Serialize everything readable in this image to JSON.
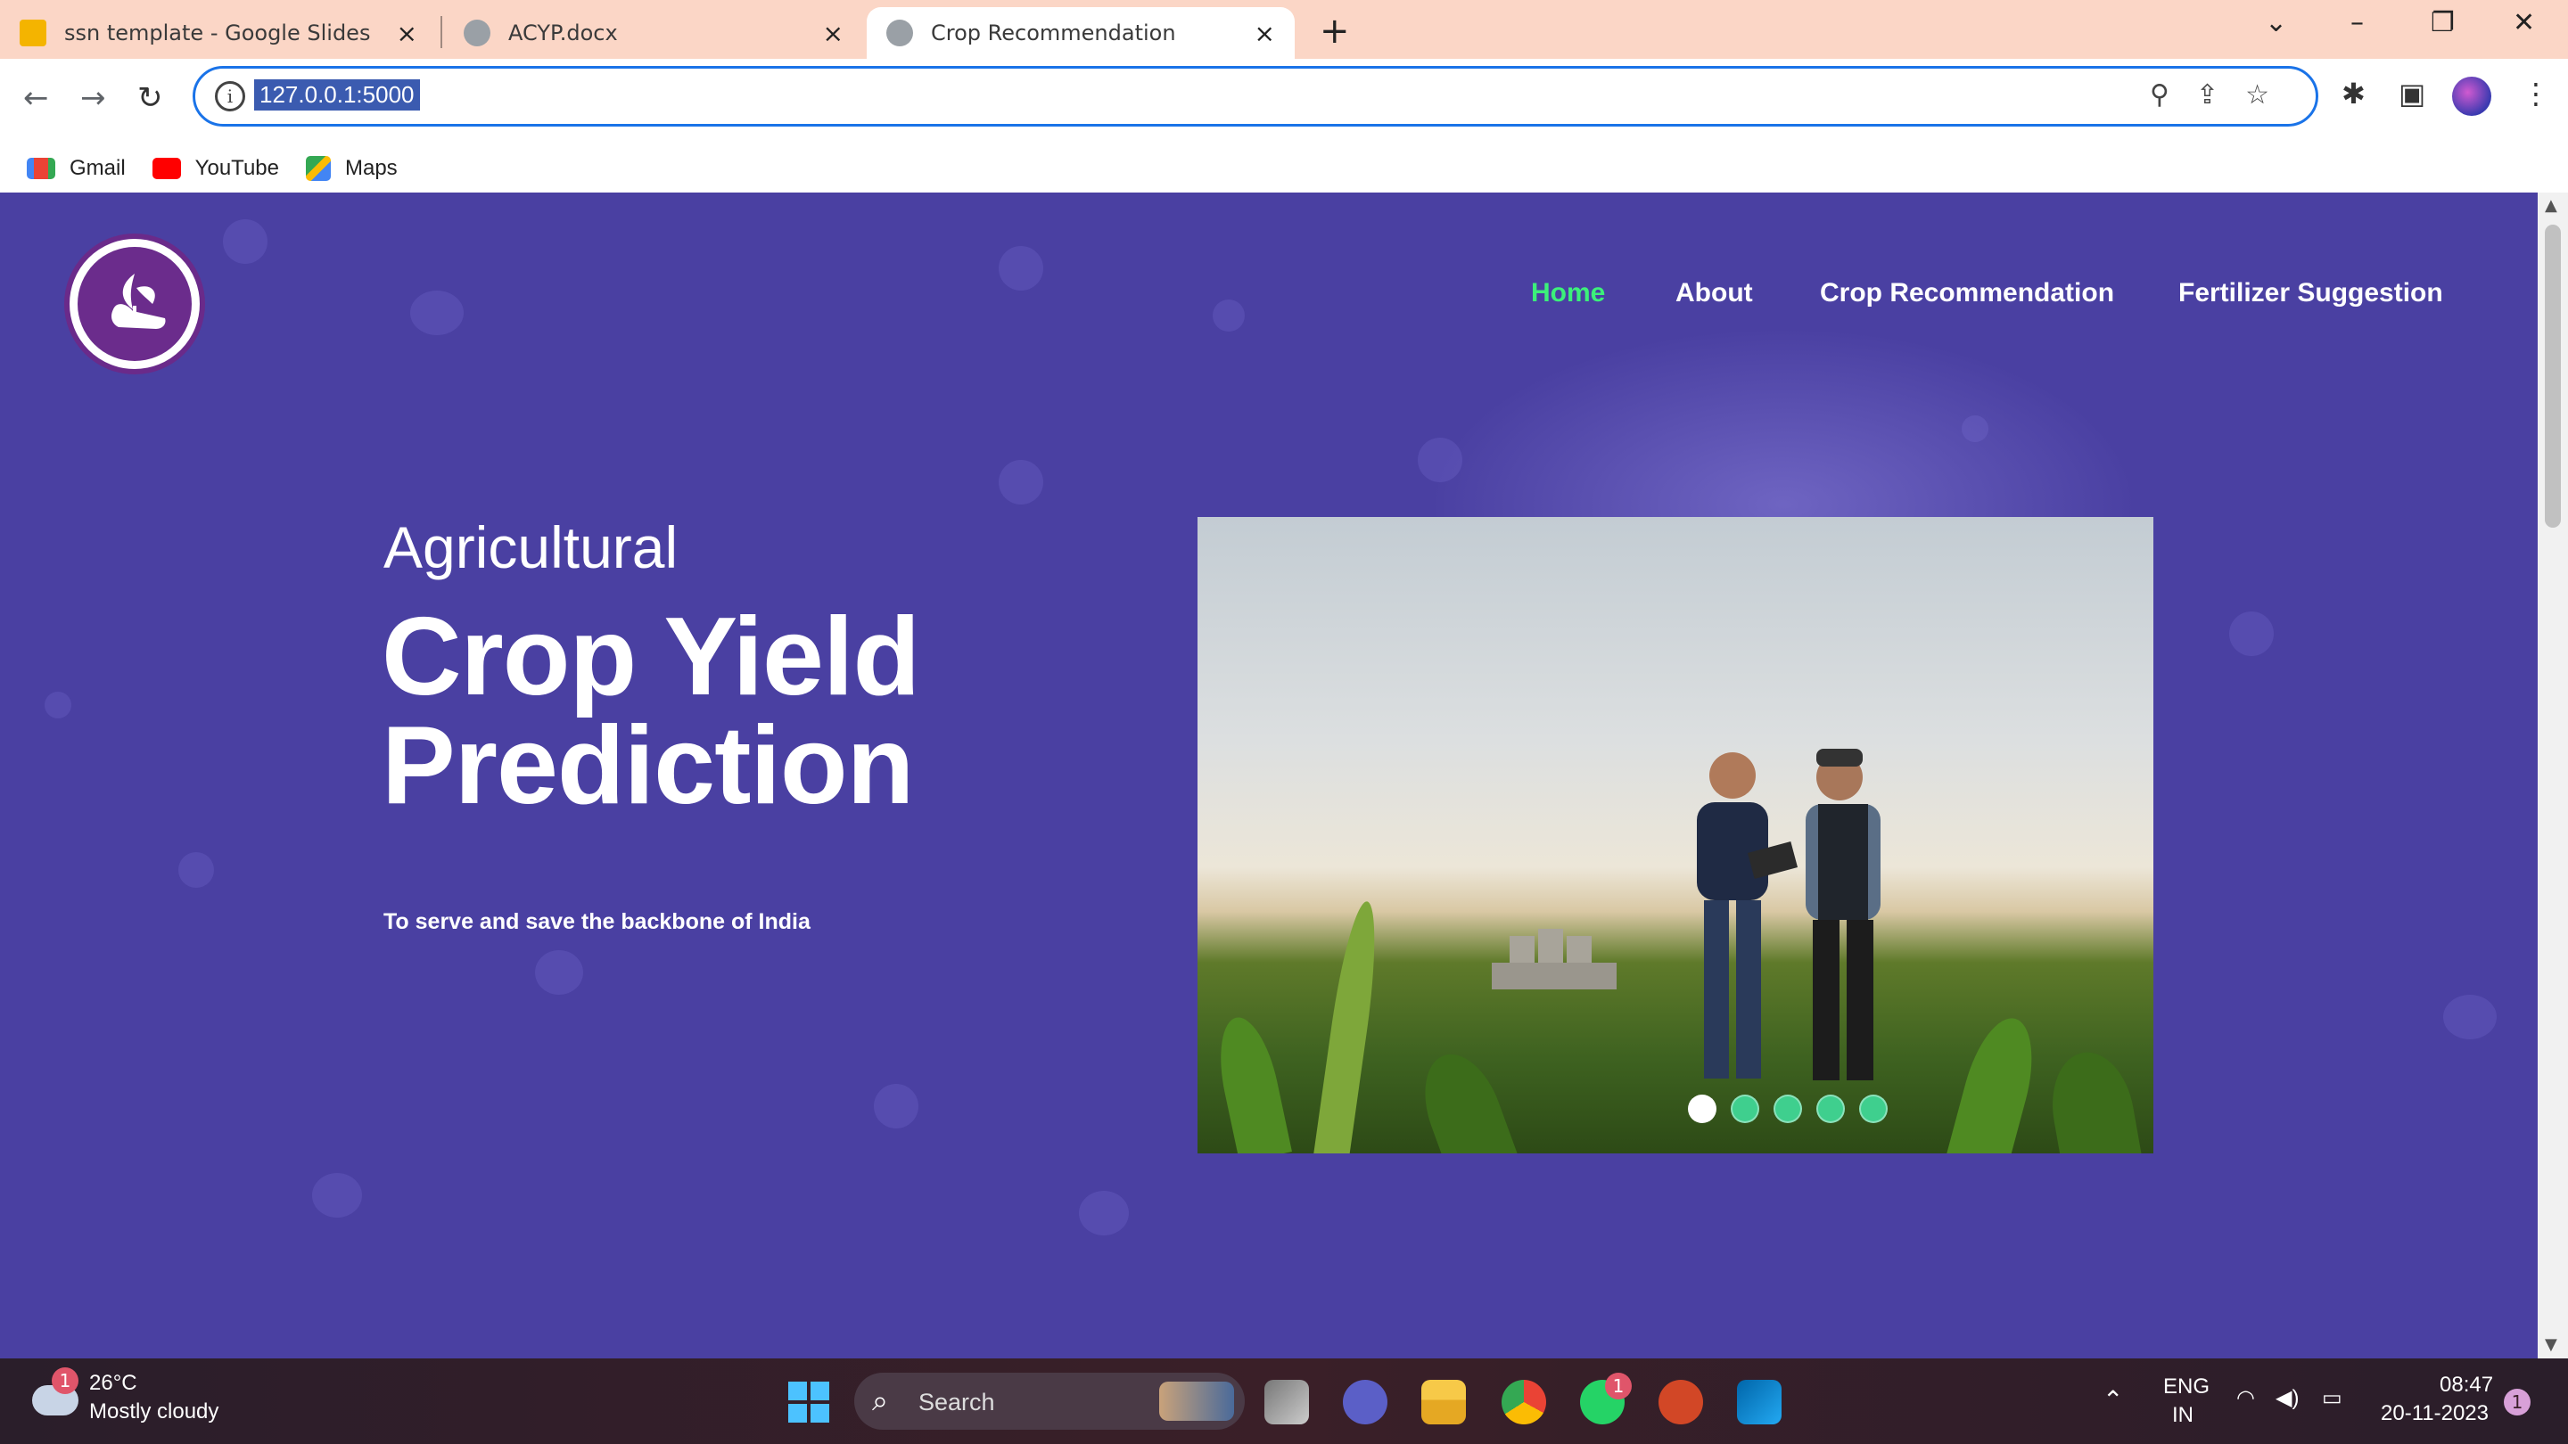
{
  "browser": {
    "tabs": [
      {
        "title": "ssn template - Google Slides",
        "icon": "google-slides-icon"
      },
      {
        "title": "ACYP.docx",
        "icon": "globe-icon"
      },
      {
        "title": "Crop Recommendation",
        "icon": "globe-icon"
      }
    ],
    "url": "127.0.0.1:5000",
    "bookmarks": [
      {
        "label": "Gmail",
        "icon": "gmail-icon"
      },
      {
        "label": "YouTube",
        "icon": "youtube-icon"
      },
      {
        "label": "Maps",
        "icon": "maps-icon"
      }
    ]
  },
  "site": {
    "nav": [
      "Home",
      "About",
      "Crop Recommendation",
      "Fertilizer Suggestion"
    ],
    "active_nav": "Home",
    "hero": {
      "subtitle": "Agricultural",
      "title_line1": "Crop Yield",
      "title_line2": "Prediction",
      "tagline": "To serve and save the backbone of India"
    },
    "carousel": {
      "slides": 5,
      "active_index": 0
    }
  },
  "taskbar": {
    "weather": {
      "temp": "26°C",
      "desc": "Mostly cloudy",
      "badge": "1"
    },
    "search_label": "Search",
    "whatsapp_badge": "1",
    "lang_line1": "ENG",
    "lang_line2": "IN",
    "time": "08:47",
    "date": "20-11-2023",
    "notification_count": "1"
  },
  "colors": {
    "page_bg": "#4a40a2",
    "nav_active": "#3cf07a",
    "carousel_dot": "#3fcf8e",
    "tab_strip": "#fbd6c6"
  }
}
